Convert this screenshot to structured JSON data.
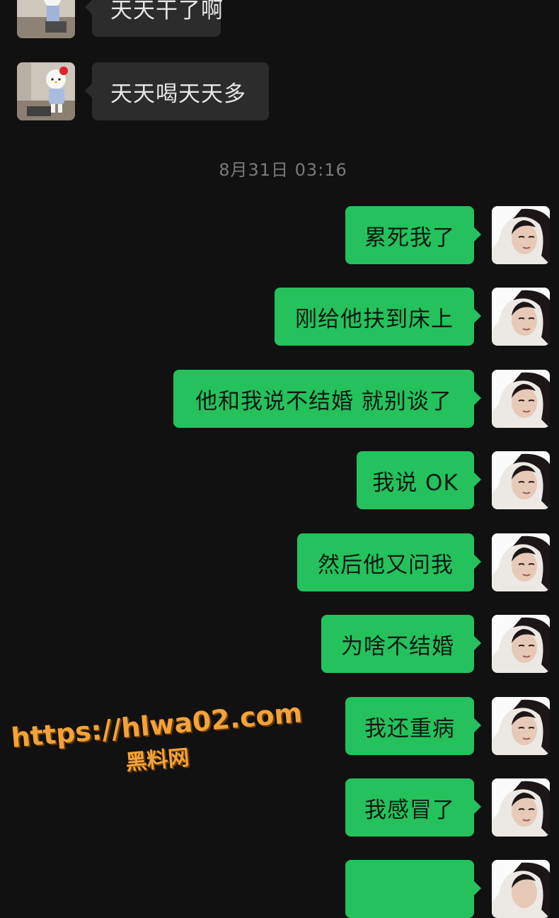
{
  "conversation": {
    "incoming": [
      {
        "text": "天天干了啊"
      },
      {
        "text": "天天喝天天多"
      }
    ],
    "timestamp": "8月31日 03:16",
    "outgoing": [
      {
        "text": "累死我了"
      },
      {
        "text": "刚给他扶到床上"
      },
      {
        "text": "他和我说不结婚 就别谈了"
      },
      {
        "text": "我说 OK"
      },
      {
        "text": "然后他又问我"
      },
      {
        "text": "为啥不结婚"
      },
      {
        "text": "我还重病"
      },
      {
        "text": "我感冒了"
      },
      {
        "text": ""
      }
    ]
  },
  "watermark": {
    "url": "https://hlwa02.com",
    "site": "黑料网"
  },
  "colors": {
    "background": "#111111",
    "incoming_bubble": "#2c2c2c",
    "outgoing_bubble": "#25c15d",
    "timestamp": "#7a7a7a",
    "watermark": "#f3a23a"
  },
  "icons": {
    "incoming_avatar": "hello-kitty-avatar-icon",
    "outgoing_avatar": "woman-portrait-avatar-icon"
  }
}
